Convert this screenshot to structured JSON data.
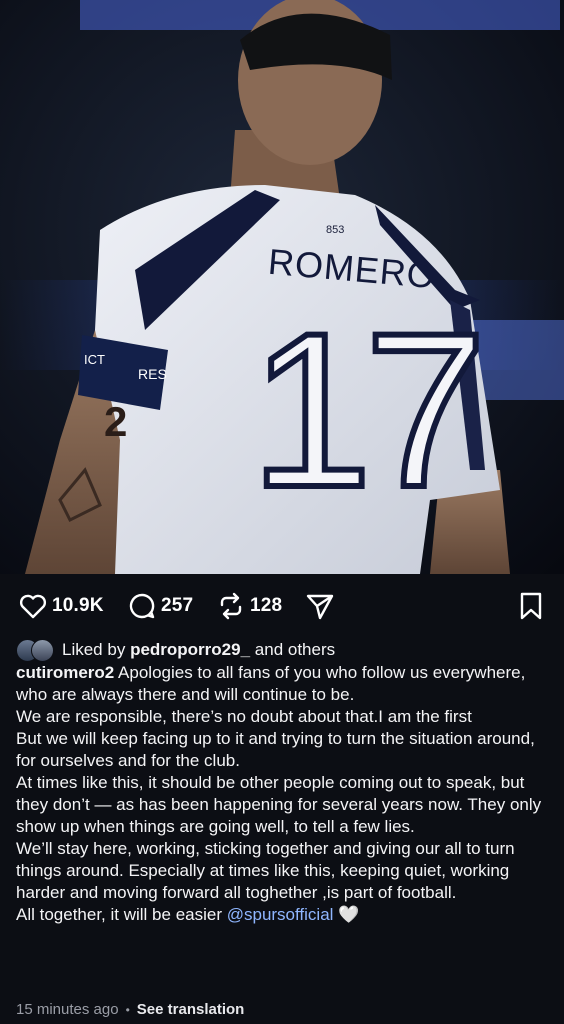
{
  "post": {
    "photo_label": "Player photo",
    "jersey": {
      "name": "ROMERO",
      "number": "17",
      "collar_code": "853",
      "armband_left": "ICT",
      "armband_right": "RES",
      "tattoo_digit": "2"
    }
  },
  "actions": {
    "likes": "10.9K",
    "comments": "257",
    "reposts": "128"
  },
  "liked_by": {
    "prefix": "Liked by",
    "user": "pedroporro29_",
    "suffix": "and others"
  },
  "caption": {
    "username": "cutiromero2",
    "p1": "Apologies to all fans of you who follow us everywhere, who are always there and will continue to be.",
    "p2": "We are responsible, there’s no doubt about that.I am the first",
    "p3": "But we will keep facing up to it and trying to turn the situation around, for ourselves and for the club.",
    "p4": "At times like this, it should be other people coming out to speak, but they don’t — as has been happening for several years now. They only show up when things are going well, to tell a few lies.",
    "p5": "We’ll stay here, working, sticking together and giving our all to turn things around. Especially at times like this, keeping quiet, working harder and moving forward all toghether ,is part of football.",
    "p6_prefix": "All together, it will be easier",
    "mention": "@spursofficial",
    "heart": "🤍"
  },
  "meta": {
    "time": "15 minutes ago",
    "separator": "•",
    "see_translation": "See translation"
  },
  "colors": {
    "background": "#0c0e14",
    "mention": "#8fb6ff",
    "muted": "#9a9da6"
  }
}
